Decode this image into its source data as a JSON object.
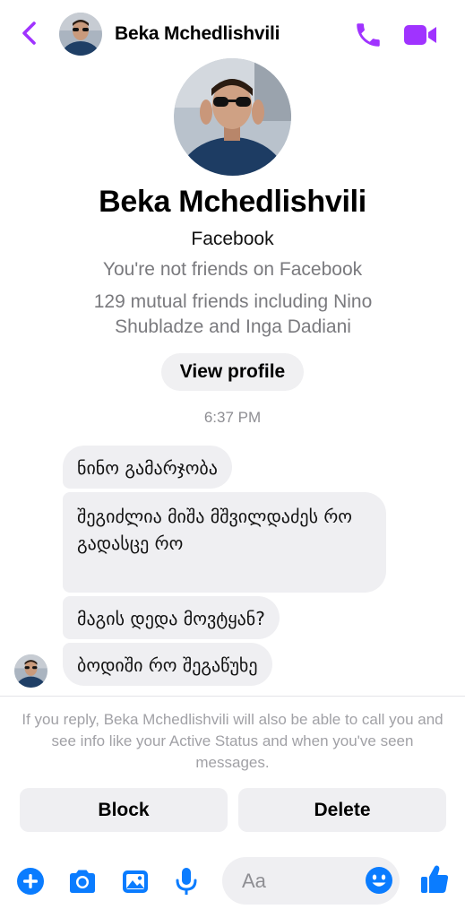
{
  "colors": {
    "accent": "#a033ff",
    "messenger_blue": "#0a7cff",
    "bubble_gray": "#efeff2",
    "secondary_text": "#7a7a7e"
  },
  "icons": {
    "back": "chevron-left-icon",
    "call": "phone-icon",
    "video": "video-camera-icon",
    "add": "plus-circle-icon",
    "camera": "camera-icon",
    "gallery": "image-icon",
    "mic": "microphone-icon",
    "emoji": "smiley-icon",
    "like": "thumbs-up-icon"
  },
  "header": {
    "name": "Beka Mchedlishvili"
  },
  "profile": {
    "name": "Beka Mchedlishvili",
    "platform": "Facebook",
    "friends_status": "You're not friends on Facebook",
    "mutual_friends": "129 mutual friends including Nino Shubladze and Inga Dadiani",
    "view_profile_label": "View profile"
  },
  "conversation": {
    "timestamp": "6:37 PM",
    "messages": [
      "ნინო გამარჯობა",
      "შეგიძლია მიშა მშვილდაძეს რო გადასცე რო",
      "მაგის დედა მოვტყან?",
      "ბოდიში რო შეგაწუხე"
    ]
  },
  "footer": {
    "notice": "If you reply, Beka Mchedlishvili will also be able to call you and see info like your Active Status and when you've seen messages.",
    "block_label": "Block",
    "delete_label": "Delete"
  },
  "composer": {
    "placeholder": "Aa"
  }
}
